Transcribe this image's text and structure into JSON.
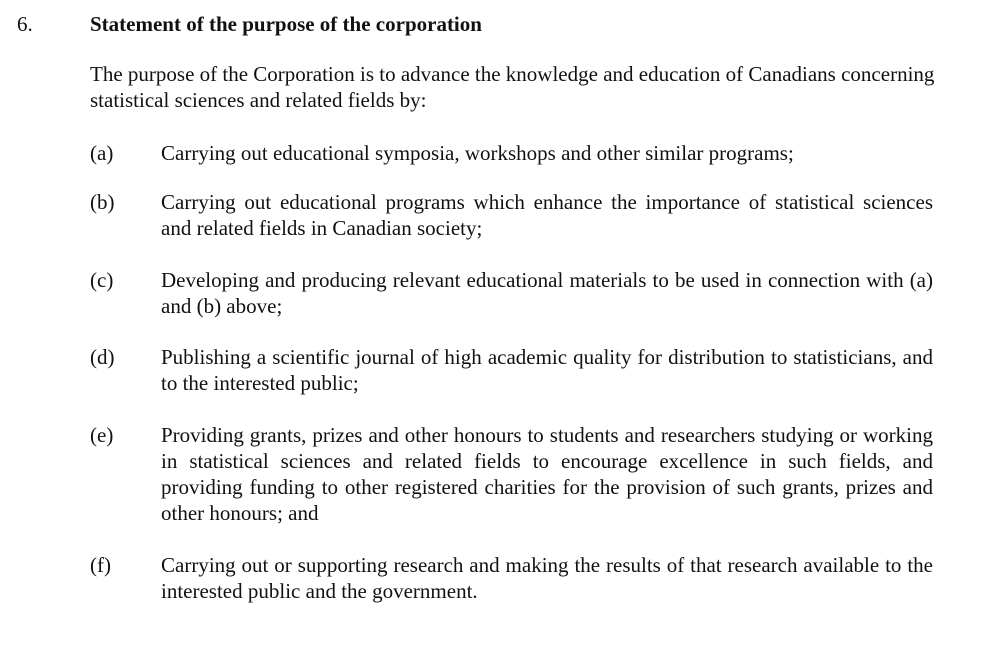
{
  "section": {
    "number": "6.",
    "title": "Statement of the purpose of the corporation",
    "intro": "The purpose of the Corporation is to advance the knowledge and education of Canadians concerning statistical sciences and related fields by:",
    "items": [
      {
        "label": "(a)",
        "text": "Carrying out educational symposia, workshops and other similar programs;"
      },
      {
        "label": "(b)",
        "text": "Carrying out educational programs which enhance the importance of statistical sciences and related fields in Canadian society;"
      },
      {
        "label": "(c)",
        "text": "Developing and producing relevant educational materials to be used in connection with (a) and (b) above;"
      },
      {
        "label": "(d)",
        "text": "Publishing a scientific journal of high academic quality for distribution to statisticians, and to the interested public;"
      },
      {
        "label": "(e)",
        "text": "Providing grants, prizes and other honours to students and researchers studying or working in statistical sciences and related fields to encourage excellence in such fields, and providing funding to other registered charities for the provision of such grants, prizes and other honours; and"
      },
      {
        "label": "(f)",
        "text": "Carrying out or supporting research and making the results of that research available to the interested public and the government."
      }
    ]
  }
}
